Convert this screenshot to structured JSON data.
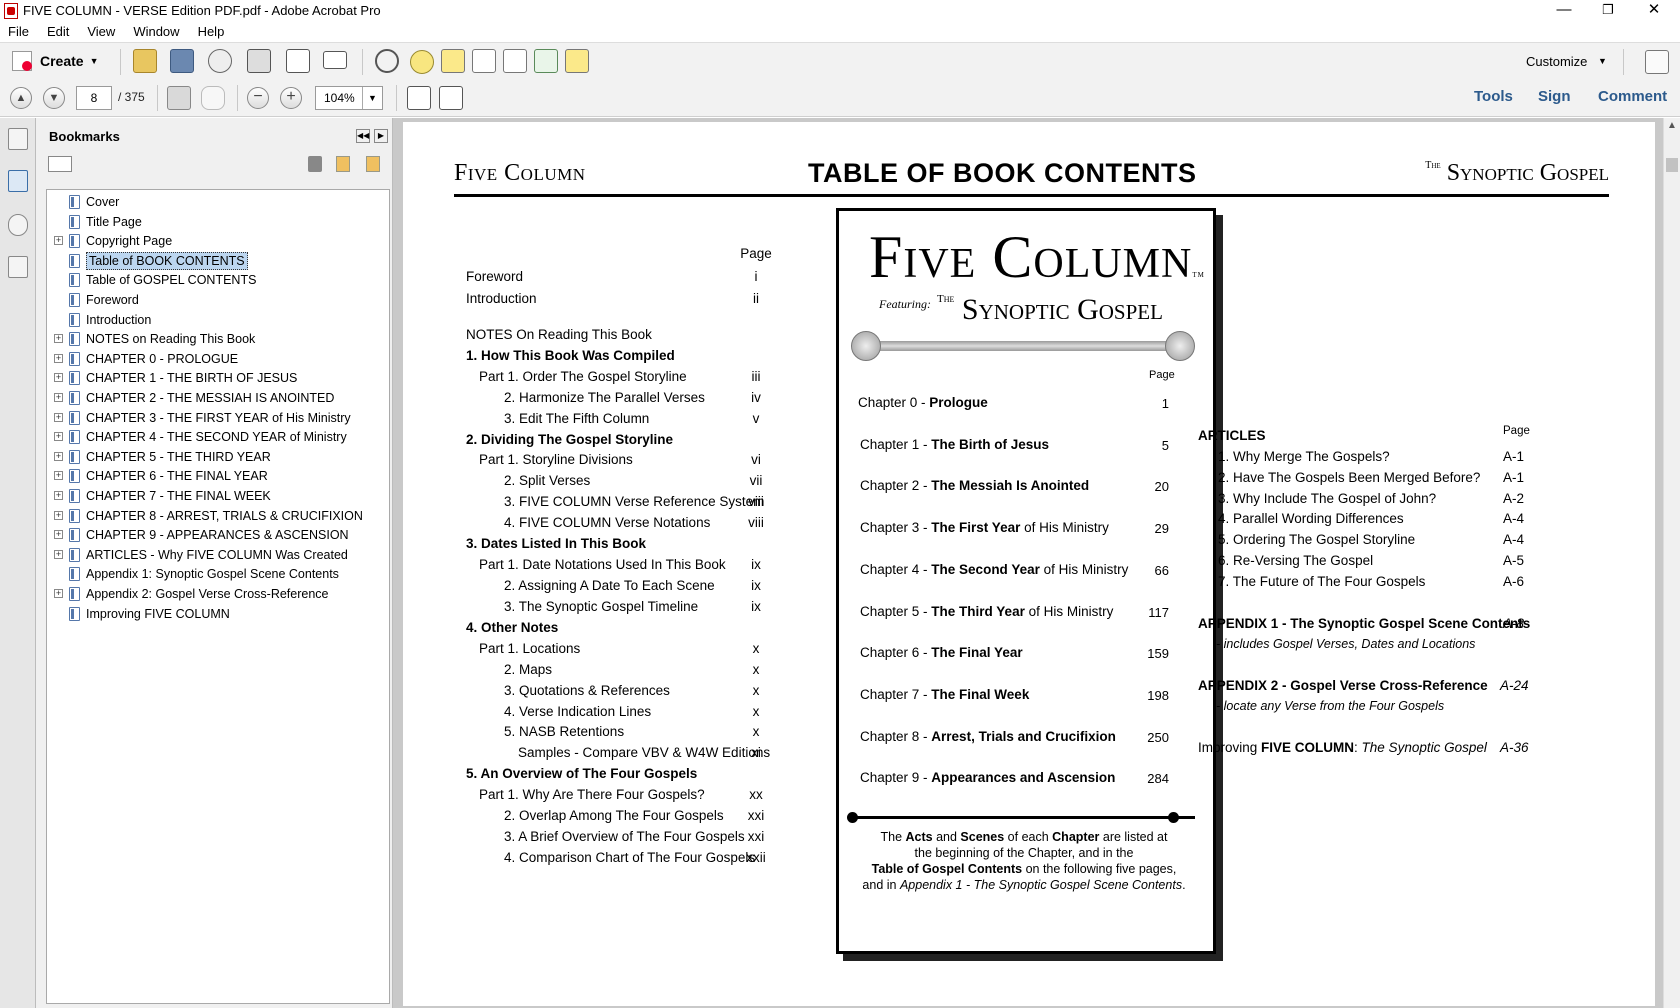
{
  "window": {
    "title": "FIVE COLUMN - VERSE Edition PDF.pdf - Adobe Acrobat Pro",
    "minimize": "—",
    "maximize": "❐",
    "close": "✕"
  },
  "menu": [
    "File",
    "Edit",
    "View",
    "Window",
    "Help"
  ],
  "toolbar": {
    "create_label": "Create",
    "customize_label": "Customize"
  },
  "nav": {
    "current_page": "8",
    "total_pages": "/ 375",
    "zoom": "104%"
  },
  "tabs": {
    "tools": "Tools",
    "sign": "Sign",
    "comment": "Comment"
  },
  "bookmarks": {
    "header": "Bookmarks",
    "items": [
      {
        "label": "Cover",
        "expandable": false
      },
      {
        "label": "Title Page",
        "expandable": false
      },
      {
        "label": "Copyright Page",
        "expandable": true
      },
      {
        "label": "Table of BOOK CONTENTS",
        "expandable": false,
        "selected": true
      },
      {
        "label": "Table of GOSPEL CONTENTS",
        "expandable": false
      },
      {
        "label": "Foreword",
        "expandable": false
      },
      {
        "label": "Introduction",
        "expandable": false
      },
      {
        "label": "NOTES on Reading This Book",
        "expandable": true
      },
      {
        "label": "CHAPTER 0 - PROLOGUE",
        "expandable": true
      },
      {
        "label": "CHAPTER 1 - THE BIRTH OF JESUS",
        "expandable": true
      },
      {
        "label": "CHAPTER 2 - THE MESSIAH IS ANOINTED",
        "expandable": true
      },
      {
        "label": "CHAPTER 3 - THE FIRST YEAR of His Ministry",
        "expandable": true
      },
      {
        "label": "CHAPTER 4 - THE SECOND YEAR of Ministry",
        "expandable": true
      },
      {
        "label": "CHAPTER 5 - THE THIRD YEAR",
        "expandable": true
      },
      {
        "label": "CHAPTER 6 - THE FINAL YEAR",
        "expandable": true
      },
      {
        "label": "CHAPTER 7 - THE FINAL WEEK",
        "expandable": true
      },
      {
        "label": "CHAPTER 8 - ARREST, TRIALS & CRUCIFIXION",
        "expandable": true
      },
      {
        "label": "CHAPTER 9 - APPEARANCES & ASCENSION",
        "expandable": true
      },
      {
        "label": "ARTICLES - Why FIVE COLUMN Was Created",
        "expandable": true
      },
      {
        "label": "Appendix 1: Synoptic Gospel Scene Contents",
        "expandable": false
      },
      {
        "label": "Appendix 2: Gospel Verse Cross-Reference",
        "expandable": true
      },
      {
        "label": "Improving FIVE COLUMN",
        "expandable": false
      }
    ]
  },
  "doc": {
    "header_left": "Five Column",
    "header_center": "TABLE OF BOOK CONTENTS",
    "header_right": "The Synoptic Gospel",
    "header_right_small": "The",
    "header_right_main": "Synoptic Gospel",
    "page_col_label": "Page",
    "left_toc": [
      {
        "text": "Foreword",
        "page": "i"
      },
      {
        "text": "Introduction",
        "page": "ii"
      },
      {
        "text": "NOTES On Reading This Book",
        "page": ""
      },
      {
        "text": "1. How This Book Was Compiled",
        "page": ""
      },
      {
        "text": "Part 1. Order The Gospel Storyline",
        "page": "iii"
      },
      {
        "text": "2. Harmonize The Parallel Verses",
        "page": "iv"
      },
      {
        "text": "3. Edit The Fifth Column",
        "page": "v"
      },
      {
        "text": "2. Dividing The Gospel Storyline",
        "page": ""
      },
      {
        "text": "Part 1. Storyline Divisions",
        "page": "vi"
      },
      {
        "text": "2. Split Verses",
        "page": "vii"
      },
      {
        "text": "3. FIVE COLUMN Verse Reference System",
        "page": "viii"
      },
      {
        "text": "4. FIVE COLUMN Verse Notations",
        "page": "viii"
      },
      {
        "text": "3. Dates Listed In This Book",
        "page": ""
      },
      {
        "text": "Part 1. Date Notations Used In This Book",
        "page": "ix"
      },
      {
        "text": "2. Assigning A Date To Each Scene",
        "page": "ix"
      },
      {
        "text": "3. The Synoptic Gospel Timeline",
        "page": "ix"
      },
      {
        "text": "4. Other Notes",
        "page": ""
      },
      {
        "text": "Part 1. Locations",
        "page": "x"
      },
      {
        "text": "2. Maps",
        "page": "x"
      },
      {
        "text": "3. Quotations & References",
        "page": "x"
      },
      {
        "text": "4. Verse Indication Lines",
        "page": "x"
      },
      {
        "text": "5. NASB Retentions",
        "page": "x"
      },
      {
        "text": "Samples - Compare VBV & W4W Editions",
        "page": "xi"
      },
      {
        "text": "5. An Overview of The Four Gospels",
        "page": ""
      },
      {
        "text": "Part 1. Why Are There Four Gospels?",
        "page": "xx"
      },
      {
        "text": "2. Overlap Among The Four Gospels",
        "page": "xxi"
      },
      {
        "text": "3. A Brief Overview of The Four Gospels",
        "page": "xxi"
      },
      {
        "text": "4. Comparison Chart of The Four Gospels",
        "page": "xxii"
      }
    ],
    "box": {
      "title": "Five Column",
      "tm": "TM",
      "featuring": "Featuring:",
      "synoptic": "Synoptic Gospel",
      "the_small": "The",
      "page_label": "Page",
      "chapters": [
        {
          "prefix": "Chapter 0 - ",
          "name": "Prologue",
          "suffix": "",
          "page": "1"
        },
        {
          "prefix": "Chapter 1 - ",
          "name": "The Birth of Jesus",
          "suffix": "",
          "page": "5"
        },
        {
          "prefix": "Chapter 2 - ",
          "name": "The Messiah Is Anointed",
          "suffix": "",
          "page": "20"
        },
        {
          "prefix": "Chapter 3 - ",
          "name": "The First Year",
          "suffix": " of His Ministry",
          "page": "29"
        },
        {
          "prefix": "Chapter 4 - ",
          "name": "The Second Year",
          "suffix": " of His Ministry",
          "page": "66"
        },
        {
          "prefix": "Chapter 5 - ",
          "name": "The Third Year",
          "suffix": " of His Ministry",
          "page": "117"
        },
        {
          "prefix": "Chapter 6 - ",
          "name": "The Final Year",
          "suffix": "",
          "page": "159"
        },
        {
          "prefix": "Chapter 7 - ",
          "name": "The Final Week",
          "suffix": "",
          "page": "198"
        },
        {
          "prefix": "Chapter 8 - ",
          "name": "Arrest, Trials and Crucifixion",
          "suffix": "",
          "page": "250"
        },
        {
          "prefix": "Chapter 9 - ",
          "name": "Appearances and Ascension",
          "suffix": "",
          "page": "284"
        }
      ],
      "note_line1_a": "The ",
      "note_line1_b": "Acts",
      "note_line1_c": " and ",
      "note_line1_d": "Scenes",
      "note_line1_e": " of each ",
      "note_line1_f": "Chapter",
      "note_line1_g": " are listed at",
      "note_line2": "the beginning of the Chapter, and in the",
      "note_line3_a": "Table of Gospel Contents",
      "note_line3_b": " on the following five pages,",
      "note_line4_a": "and in ",
      "note_line4_b": "Appendix 1 - The Synoptic Gospel Scene Contents",
      "note_line4_c": "."
    },
    "articles": {
      "heading": "ARTICLES",
      "page_label": "Page",
      "items": [
        {
          "text": "1. Why Merge The Gospels?",
          "page": "A-1"
        },
        {
          "text": "2. Have The Gospels Been Merged Before?",
          "page": "A-1"
        },
        {
          "text": "3. Why Include The Gospel of John?",
          "page": "A-2"
        },
        {
          "text": "4. Parallel Wording Differences",
          "page": "A-4"
        },
        {
          "text": "5. Ordering The Gospel Storyline",
          "page": "A-4"
        },
        {
          "text": "6. Re-Versing The Gospel",
          "page": "A-5"
        },
        {
          "text": "7. The Future of The Four Gospels",
          "page": "A-6"
        }
      ],
      "appendix1_title": "APPENDIX 1 - The Synoptic Gospel Scene Contents",
      "appendix1_sub": "- includes Gospel Verses, Dates and Locations",
      "appendix1_page": "A-8",
      "appendix2_title": "APPENDIX 2 - Gospel Verse Cross-Reference",
      "appendix2_sub": "- locate any Verse from the Four Gospels",
      "appendix2_page": "A-24",
      "improving_a": "Improving  ",
      "improving_b": "FIVE COLUMN",
      "improving_c": ": ",
      "improving_d": "The Synoptic Gospel",
      "improving_page": "A-36"
    }
  }
}
